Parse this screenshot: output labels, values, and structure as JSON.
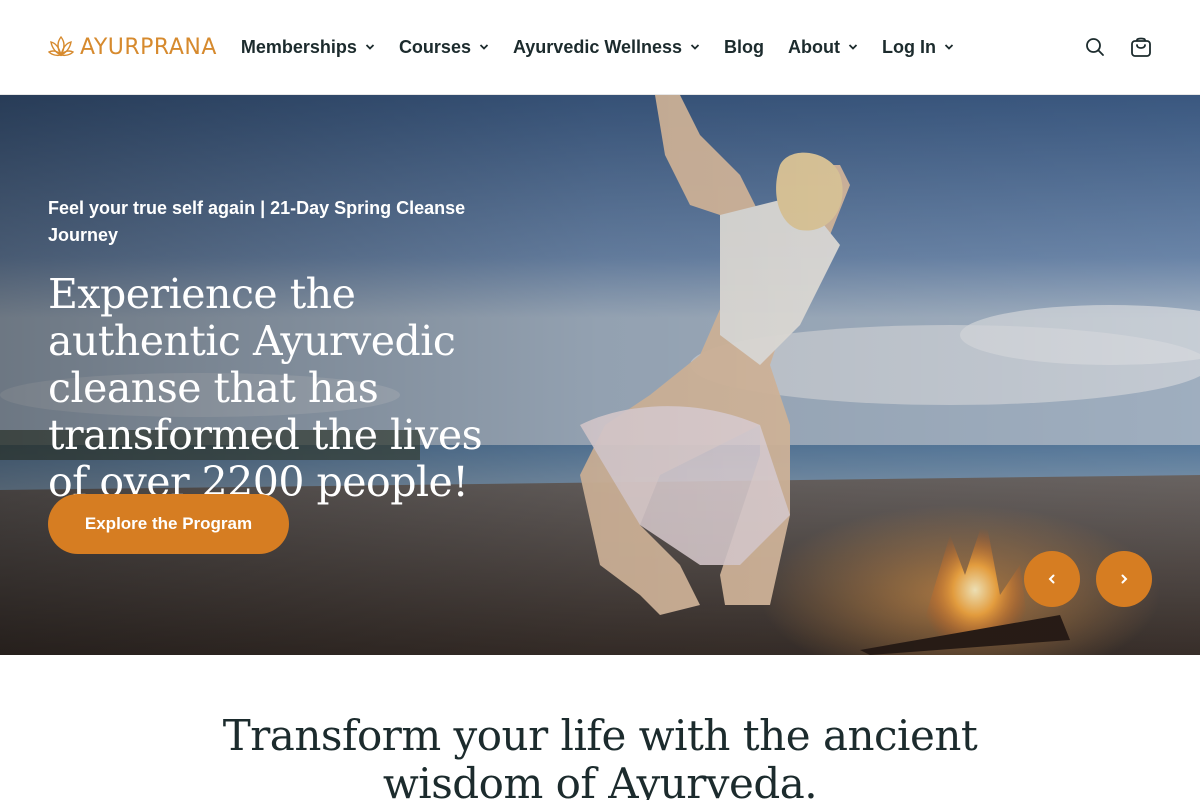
{
  "brand": {
    "name": "AYURPRANA",
    "accent": "#d68a2e",
    "button": "#d67d22"
  },
  "nav": {
    "items": [
      {
        "label": "Memberships",
        "dropdown": true
      },
      {
        "label": "Courses",
        "dropdown": true
      },
      {
        "label": "Ayurvedic Wellness",
        "dropdown": true
      },
      {
        "label": "Blog",
        "dropdown": false
      },
      {
        "label": "About",
        "dropdown": true
      },
      {
        "label": "Log In",
        "dropdown": true
      }
    ],
    "icons": [
      "search-icon",
      "shopping-bag-icon"
    ]
  },
  "hero": {
    "eyebrow": "Feel your true self again | 21-Day Spring Cleanse Journey",
    "headline": "Experience the authentic Ayurvedic cleanse that has transformed the lives of over 2200 people!",
    "cta_label": "Explore the Program",
    "image": "woman in yoga pose on beach beside campfire at sunset",
    "prev_icon": "chevron-left-icon",
    "next_icon": "chevron-right-icon"
  },
  "section": {
    "title_line1": "Transform your life with the ancient",
    "title_line2": "wisdom of Ayurveda."
  }
}
